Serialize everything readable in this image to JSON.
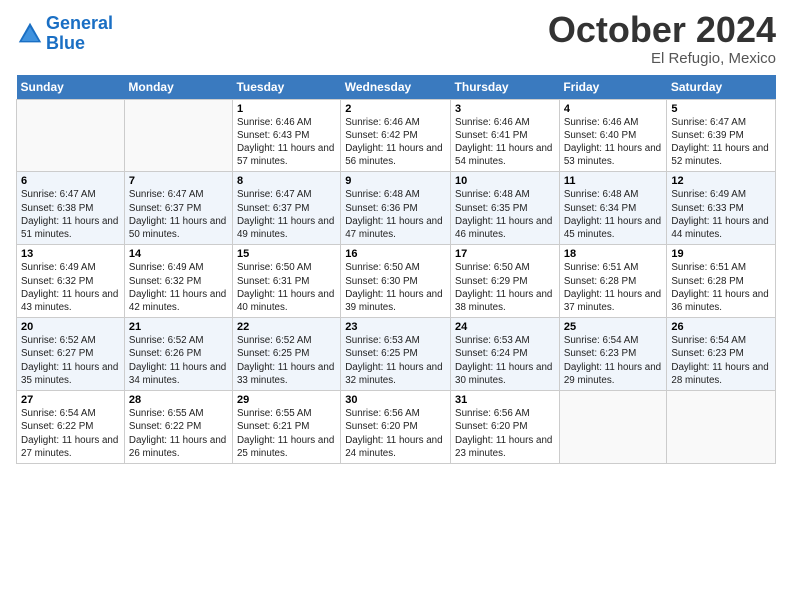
{
  "header": {
    "logo_line1": "General",
    "logo_line2": "Blue",
    "month": "October 2024",
    "location": "El Refugio, Mexico"
  },
  "weekdays": [
    "Sunday",
    "Monday",
    "Tuesday",
    "Wednesday",
    "Thursday",
    "Friday",
    "Saturday"
  ],
  "weeks": [
    [
      {
        "day": "",
        "info": ""
      },
      {
        "day": "",
        "info": ""
      },
      {
        "day": "1",
        "info": "Sunrise: 6:46 AM\nSunset: 6:43 PM\nDaylight: 11 hours and 57 minutes."
      },
      {
        "day": "2",
        "info": "Sunrise: 6:46 AM\nSunset: 6:42 PM\nDaylight: 11 hours and 56 minutes."
      },
      {
        "day": "3",
        "info": "Sunrise: 6:46 AM\nSunset: 6:41 PM\nDaylight: 11 hours and 54 minutes."
      },
      {
        "day": "4",
        "info": "Sunrise: 6:46 AM\nSunset: 6:40 PM\nDaylight: 11 hours and 53 minutes."
      },
      {
        "day": "5",
        "info": "Sunrise: 6:47 AM\nSunset: 6:39 PM\nDaylight: 11 hours and 52 minutes."
      }
    ],
    [
      {
        "day": "6",
        "info": "Sunrise: 6:47 AM\nSunset: 6:38 PM\nDaylight: 11 hours and 51 minutes."
      },
      {
        "day": "7",
        "info": "Sunrise: 6:47 AM\nSunset: 6:37 PM\nDaylight: 11 hours and 50 minutes."
      },
      {
        "day": "8",
        "info": "Sunrise: 6:47 AM\nSunset: 6:37 PM\nDaylight: 11 hours and 49 minutes."
      },
      {
        "day": "9",
        "info": "Sunrise: 6:48 AM\nSunset: 6:36 PM\nDaylight: 11 hours and 47 minutes."
      },
      {
        "day": "10",
        "info": "Sunrise: 6:48 AM\nSunset: 6:35 PM\nDaylight: 11 hours and 46 minutes."
      },
      {
        "day": "11",
        "info": "Sunrise: 6:48 AM\nSunset: 6:34 PM\nDaylight: 11 hours and 45 minutes."
      },
      {
        "day": "12",
        "info": "Sunrise: 6:49 AM\nSunset: 6:33 PM\nDaylight: 11 hours and 44 minutes."
      }
    ],
    [
      {
        "day": "13",
        "info": "Sunrise: 6:49 AM\nSunset: 6:32 PM\nDaylight: 11 hours and 43 minutes."
      },
      {
        "day": "14",
        "info": "Sunrise: 6:49 AM\nSunset: 6:32 PM\nDaylight: 11 hours and 42 minutes."
      },
      {
        "day": "15",
        "info": "Sunrise: 6:50 AM\nSunset: 6:31 PM\nDaylight: 11 hours and 40 minutes."
      },
      {
        "day": "16",
        "info": "Sunrise: 6:50 AM\nSunset: 6:30 PM\nDaylight: 11 hours and 39 minutes."
      },
      {
        "day": "17",
        "info": "Sunrise: 6:50 AM\nSunset: 6:29 PM\nDaylight: 11 hours and 38 minutes."
      },
      {
        "day": "18",
        "info": "Sunrise: 6:51 AM\nSunset: 6:28 PM\nDaylight: 11 hours and 37 minutes."
      },
      {
        "day": "19",
        "info": "Sunrise: 6:51 AM\nSunset: 6:28 PM\nDaylight: 11 hours and 36 minutes."
      }
    ],
    [
      {
        "day": "20",
        "info": "Sunrise: 6:52 AM\nSunset: 6:27 PM\nDaylight: 11 hours and 35 minutes."
      },
      {
        "day": "21",
        "info": "Sunrise: 6:52 AM\nSunset: 6:26 PM\nDaylight: 11 hours and 34 minutes."
      },
      {
        "day": "22",
        "info": "Sunrise: 6:52 AM\nSunset: 6:25 PM\nDaylight: 11 hours and 33 minutes."
      },
      {
        "day": "23",
        "info": "Sunrise: 6:53 AM\nSunset: 6:25 PM\nDaylight: 11 hours and 32 minutes."
      },
      {
        "day": "24",
        "info": "Sunrise: 6:53 AM\nSunset: 6:24 PM\nDaylight: 11 hours and 30 minutes."
      },
      {
        "day": "25",
        "info": "Sunrise: 6:54 AM\nSunset: 6:23 PM\nDaylight: 11 hours and 29 minutes."
      },
      {
        "day": "26",
        "info": "Sunrise: 6:54 AM\nSunset: 6:23 PM\nDaylight: 11 hours and 28 minutes."
      }
    ],
    [
      {
        "day": "27",
        "info": "Sunrise: 6:54 AM\nSunset: 6:22 PM\nDaylight: 11 hours and 27 minutes."
      },
      {
        "day": "28",
        "info": "Sunrise: 6:55 AM\nSunset: 6:22 PM\nDaylight: 11 hours and 26 minutes."
      },
      {
        "day": "29",
        "info": "Sunrise: 6:55 AM\nSunset: 6:21 PM\nDaylight: 11 hours and 25 minutes."
      },
      {
        "day": "30",
        "info": "Sunrise: 6:56 AM\nSunset: 6:20 PM\nDaylight: 11 hours and 24 minutes."
      },
      {
        "day": "31",
        "info": "Sunrise: 6:56 AM\nSunset: 6:20 PM\nDaylight: 11 hours and 23 minutes."
      },
      {
        "day": "",
        "info": ""
      },
      {
        "day": "",
        "info": ""
      }
    ]
  ]
}
